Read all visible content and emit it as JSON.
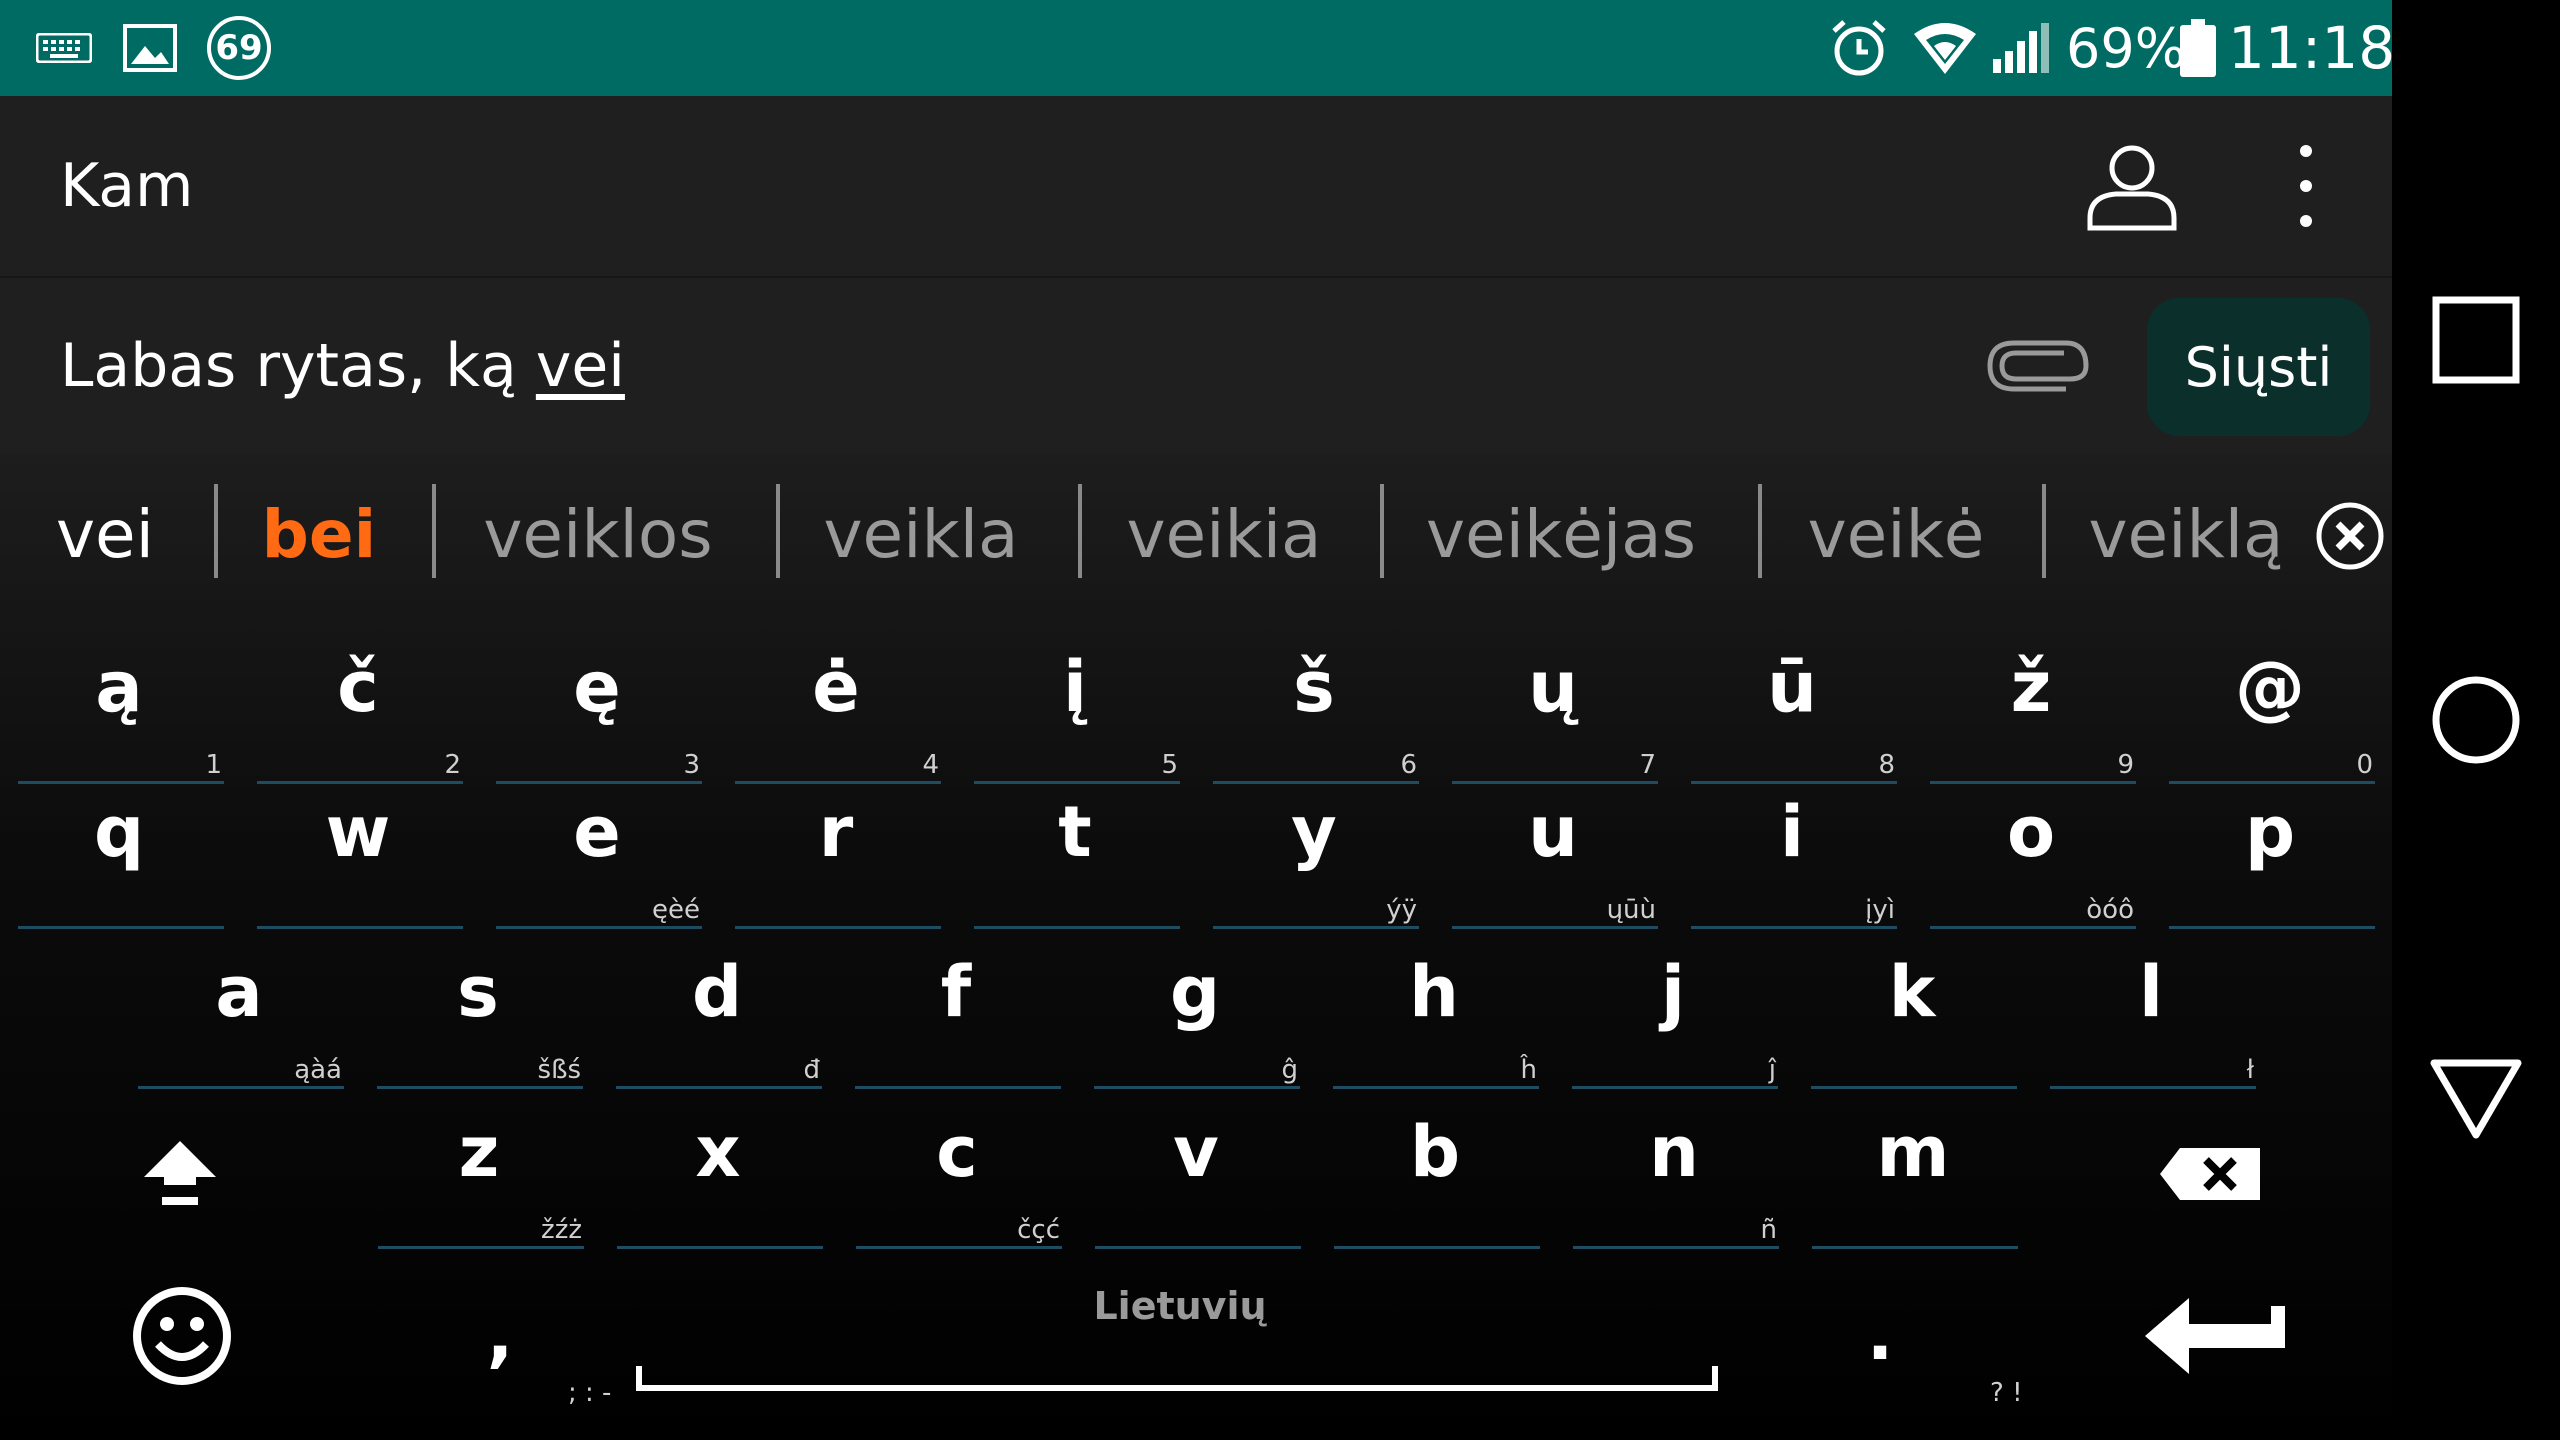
{
  "status_bar": {
    "notification_badge": "69",
    "battery": "69%",
    "time": "11:18",
    "left_icons": [
      "keyboard-icon",
      "gallery-icon",
      "badge-icon"
    ],
    "right_icons": [
      "alarm-icon",
      "wifi-icon",
      "signal-icon",
      "battery-icon"
    ]
  },
  "header": {
    "to_label": "Kam"
  },
  "compose": {
    "message_prefix": "Labas rytas, ką ",
    "message_word": "vei",
    "send_label": "Siųsti"
  },
  "suggestions": {
    "typed": "vei",
    "items": [
      "bei",
      "veiklos",
      "veikla",
      "veikia",
      "veikėjas",
      "veikė",
      "veiklą"
    ]
  },
  "keyboard": {
    "row_numbers": [
      {
        "key": "ą",
        "hint": "1"
      },
      {
        "key": "č",
        "hint": "2"
      },
      {
        "key": "ę",
        "hint": "3"
      },
      {
        "key": "ė",
        "hint": "4"
      },
      {
        "key": "į",
        "hint": "5"
      },
      {
        "key": "š",
        "hint": "6"
      },
      {
        "key": "ų",
        "hint": "7"
      },
      {
        "key": "ū",
        "hint": "8"
      },
      {
        "key": "ž",
        "hint": "9"
      },
      {
        "key": "@",
        "hint": "0"
      }
    ],
    "row_top": [
      {
        "key": "q",
        "hint": ""
      },
      {
        "key": "w",
        "hint": ""
      },
      {
        "key": "e",
        "hint": "ęèé"
      },
      {
        "key": "r",
        "hint": ""
      },
      {
        "key": "t",
        "hint": ""
      },
      {
        "key": "y",
        "hint": "ýÿ"
      },
      {
        "key": "u",
        "hint": "ųūù"
      },
      {
        "key": "i",
        "hint": "įyì"
      },
      {
        "key": "o",
        "hint": "òóô"
      },
      {
        "key": "p",
        "hint": ""
      }
    ],
    "row_home": [
      {
        "key": "a",
        "hint": "ąàá"
      },
      {
        "key": "s",
        "hint": "šßś"
      },
      {
        "key": "d",
        "hint": "đ"
      },
      {
        "key": "f",
        "hint": ""
      },
      {
        "key": "g",
        "hint": "ĝ"
      },
      {
        "key": "h",
        "hint": "ĥ"
      },
      {
        "key": "j",
        "hint": "ĵ"
      },
      {
        "key": "k",
        "hint": ""
      },
      {
        "key": "l",
        "hint": "ł"
      }
    ],
    "row_bottom": [
      {
        "key": "z",
        "hint": "žźż"
      },
      {
        "key": "x",
        "hint": ""
      },
      {
        "key": "c",
        "hint": "čçć"
      },
      {
        "key": "v",
        "hint": ""
      },
      {
        "key": "b",
        "hint": ""
      },
      {
        "key": "n",
        "hint": "ñ"
      },
      {
        "key": "m",
        "hint": ""
      }
    ],
    "comma_key": ",",
    "comma_hint": "; : -",
    "period_key": ".",
    "period_hint": "? !",
    "space_label": "Lietuvių",
    "icons": [
      "shift-icon",
      "backspace-icon",
      "emoji-icon",
      "enter-icon"
    ]
  },
  "nav": {
    "icons": [
      "recents-icon",
      "home-icon",
      "back-icon"
    ]
  },
  "colors": {
    "status_bar": "#006b63",
    "send_button": "#0b2f2b",
    "accent": "#ff6a13",
    "key_underline": "#1f4c63"
  }
}
